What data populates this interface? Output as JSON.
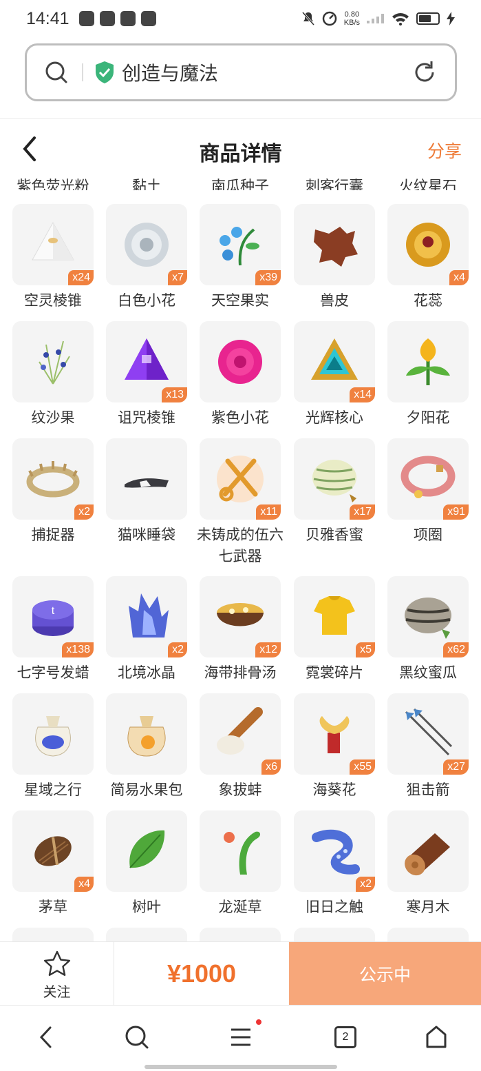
{
  "status_bar": {
    "time": "14:41",
    "net_speed_value": "0.80",
    "net_speed_unit": "KB/s"
  },
  "url_bar": {
    "title": "创造与魔法"
  },
  "header": {
    "title": "商品详情",
    "share": "分享"
  },
  "cut_row": [
    "紫色荧光粉",
    "黏土",
    "南瓜种子",
    "刺客行囊",
    "火纹星石"
  ],
  "items": [
    {
      "name": "空灵棱锥",
      "badge": "x24",
      "icon": "white-pyramid-icon"
    },
    {
      "name": "白色小花",
      "badge": "x7",
      "icon": "white-flower-icon"
    },
    {
      "name": "天空果实",
      "badge": "x39",
      "icon": "sky-fruit-icon"
    },
    {
      "name": "兽皮",
      "badge": "",
      "icon": "animal-hide-icon"
    },
    {
      "name": "花蕊",
      "badge": "x4",
      "icon": "stamen-icon"
    },
    {
      "name": "纹沙果",
      "badge": "",
      "icon": "sand-fruit-icon"
    },
    {
      "name": "诅咒棱锥",
      "badge": "x13",
      "icon": "purple-pyramid-icon"
    },
    {
      "name": "紫色小花",
      "badge": "",
      "icon": "magenta-flower-icon"
    },
    {
      "name": "光辉核心",
      "badge": "x14",
      "icon": "radiant-core-icon"
    },
    {
      "name": "夕阳花",
      "badge": "",
      "icon": "sunset-flower-icon"
    },
    {
      "name": "捕捉器",
      "badge": "x2",
      "icon": "trap-icon"
    },
    {
      "name": "猫咪睡袋",
      "badge": "",
      "icon": "cat-sleeping-bag-icon"
    },
    {
      "name": "未铸成的伍六七武器",
      "badge": "x11",
      "icon": "scissors-weapon-icon"
    },
    {
      "name": "贝雅香蜜",
      "badge": "x17",
      "icon": "melon-icon"
    },
    {
      "name": "项圈",
      "badge": "x91",
      "icon": "collar-icon"
    },
    {
      "name": "七字号发蜡",
      "badge": "x138",
      "icon": "hair-wax-icon"
    },
    {
      "name": "北境冰晶",
      "badge": "x2",
      "icon": "ice-crystal-icon"
    },
    {
      "name": "海带排骨汤",
      "badge": "x12",
      "icon": "soup-bowl-icon"
    },
    {
      "name": "霓裳碎片",
      "badge": "x5",
      "icon": "shirt-fragment-icon"
    },
    {
      "name": "黑纹蜜瓜",
      "badge": "x62",
      "icon": "dark-melon-icon"
    },
    {
      "name": "星域之行",
      "badge": "",
      "icon": "star-bag-icon"
    },
    {
      "name": "简易水果包",
      "badge": "",
      "icon": "fruit-bag-icon"
    },
    {
      "name": "象拔蚌",
      "badge": "x6",
      "icon": "geoduck-icon"
    },
    {
      "name": "海葵花",
      "badge": "x55",
      "icon": "anemone-icon"
    },
    {
      "name": "狙击箭",
      "badge": "x27",
      "icon": "arrows-icon"
    },
    {
      "name": "茅草",
      "badge": "x4",
      "icon": "thatch-icon"
    },
    {
      "name": "树叶",
      "badge": "",
      "icon": "leaf-icon"
    },
    {
      "name": "龙涎草",
      "badge": "",
      "icon": "dragon-grass-icon"
    },
    {
      "name": "旧日之触",
      "badge": "x2",
      "icon": "tentacle-icon"
    },
    {
      "name": "寒月木",
      "badge": "",
      "icon": "log-icon"
    }
  ],
  "action_bar": {
    "follow": "关注",
    "price": "¥1000",
    "status": "公示中"
  },
  "browser_nav": {
    "tab_count": "2"
  },
  "colors": {
    "accent": "#ee7a36",
    "badge": "#f0813f",
    "publish_bg": "#f7a77a",
    "price": "#f0712d"
  }
}
